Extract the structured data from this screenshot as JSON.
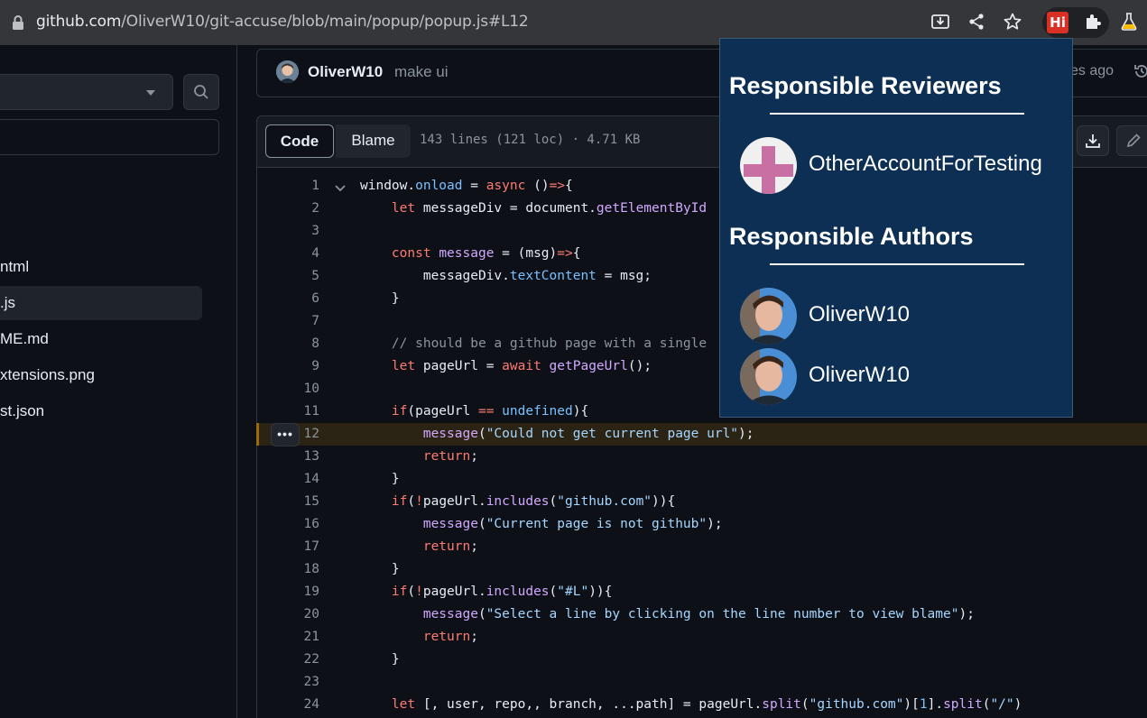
{
  "browser": {
    "url_domain": "github.com",
    "url_path": "/OliverW10/git-accuse/blob/main/popup/popup.js#L12",
    "extension_badge": "Hi"
  },
  "file_tree": {
    "items": [
      {
        "label": "ntml",
        "active": false
      },
      {
        "label": ".js",
        "active": true
      },
      {
        "label": "ME.md",
        "active": false
      },
      {
        "label": "xtensions.png",
        "active": false
      },
      {
        "label": "st.json",
        "active": false
      }
    ]
  },
  "commit": {
    "author": "OliverW10",
    "message": "make ui",
    "time": "es ago"
  },
  "file_header": {
    "code_tab": "Code",
    "blame_tab": "Blame",
    "stats": "143 lines (121 loc) · 4.71 KB"
  },
  "code": {
    "highlighted_line": 12,
    "more_button": "•••",
    "lines": [
      {
        "n": "1",
        "text": "window.onload = async ()=>{"
      },
      {
        "n": "2",
        "text": "    let messageDiv = document.getElementById"
      },
      {
        "n": "3",
        "text": ""
      },
      {
        "n": "4",
        "text": "    const message = (msg)=>{"
      },
      {
        "n": "5",
        "text": "        messageDiv.textContent = msg;"
      },
      {
        "n": "6",
        "text": "    }"
      },
      {
        "n": "7",
        "text": ""
      },
      {
        "n": "8",
        "text": "    // should be a github page with a single"
      },
      {
        "n": "9",
        "text": "    let pageUrl = await getPageUrl();"
      },
      {
        "n": "10",
        "text": ""
      },
      {
        "n": "11",
        "text": "    if(pageUrl == undefined){"
      },
      {
        "n": "12",
        "text": "        message(\"Could not get current page url\");"
      },
      {
        "n": "13",
        "text": "        return;"
      },
      {
        "n": "14",
        "text": "    }"
      },
      {
        "n": "15",
        "text": "    if(!pageUrl.includes(\"github.com\")){"
      },
      {
        "n": "16",
        "text": "        message(\"Current page is not github\");"
      },
      {
        "n": "17",
        "text": "        return;"
      },
      {
        "n": "18",
        "text": "    }"
      },
      {
        "n": "19",
        "text": "    if(!pageUrl.includes(\"#L\")){"
      },
      {
        "n": "20",
        "text": "        message(\"Select a line by clicking on the line number to view blame\");"
      },
      {
        "n": "21",
        "text": "        return;"
      },
      {
        "n": "22",
        "text": "    }"
      },
      {
        "n": "23",
        "text": ""
      },
      {
        "n": "24",
        "text": "    let [, user, repo,, branch, ...path] = pageUrl.split(\"github.com\")[1].split(\"/\")"
      }
    ]
  },
  "popup": {
    "reviewers_heading": "Responsible Reviewers",
    "reviewers": [
      "OtherAccountForTesting"
    ],
    "authors_heading": "Responsible Authors",
    "authors": [
      "OliverW10",
      "OliverW10"
    ]
  }
}
